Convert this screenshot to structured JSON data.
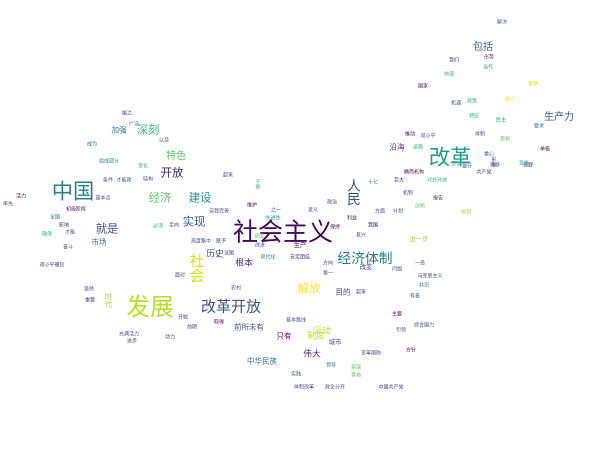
{
  "words": [
    {
      "text": "社会主义",
      "weight": 20,
      "color": "#46085c"
    },
    {
      "text": "发展",
      "weight": 19,
      "color": "#b5de2b"
    },
    {
      "text": "中国",
      "weight": 17,
      "color": "#26828e"
    },
    {
      "text": "改革",
      "weight": 17,
      "color": "#1f9e89"
    },
    {
      "text": "改革开放",
      "weight": 12,
      "color": "#3b528b"
    },
    {
      "text": "经济体制",
      "weight": 11,
      "color": "#287d8e"
    },
    {
      "text": "人民",
      "weight": 11,
      "color": "#3b528b"
    },
    {
      "text": "社会",
      "weight": 12,
      "color": "#d8e219"
    },
    {
      "text": "深刻",
      "weight": 9,
      "color": "#35b779"
    },
    {
      "text": "开放",
      "weight": 9,
      "color": "#2d1f5e"
    },
    {
      "text": "经济",
      "weight": 9,
      "color": "#5ec962"
    },
    {
      "text": "建设",
      "weight": 9,
      "color": "#21918c"
    },
    {
      "text": "实现",
      "weight": 9,
      "color": "#3b528b"
    },
    {
      "text": "就是",
      "weight": 9,
      "color": "#3e4989"
    },
    {
      "text": "特色",
      "weight": 8,
      "color": "#5ec962"
    },
    {
      "text": "解放",
      "weight": 9,
      "color": "#fde725"
    },
    {
      "text": "生产力",
      "weight": 8,
      "color": "#3b528b"
    },
    {
      "text": "包括",
      "weight": 8,
      "color": "#31688e"
    },
    {
      "text": "历史",
      "weight": 7,
      "color": "#404688"
    },
    {
      "text": "根本",
      "weight": 7,
      "color": "#482878"
    },
    {
      "text": "制度",
      "weight": 7,
      "color": "#c2df23"
    },
    {
      "text": "伟大",
      "weight": 7,
      "color": "#472d7b"
    },
    {
      "text": "运动",
      "weight": 7,
      "color": "#b5de2b"
    },
    {
      "text": "前所未有",
      "weight": 6,
      "color": "#39568c"
    },
    {
      "text": "只有",
      "weight": 6,
      "color": "#46085c"
    },
    {
      "text": "沿海",
      "weight": 6,
      "color": "#482475"
    },
    {
      "text": "市场",
      "weight": 6,
      "color": "#31688e"
    },
    {
      "text": "时代",
      "weight": 6,
      "color": "#a0da39"
    },
    {
      "text": "中华民族",
      "weight": 6,
      "color": "#2c728e"
    },
    {
      "text": "加强",
      "weight": 6,
      "color": "#2d708e"
    },
    {
      "text": "目的",
      "weight": 6,
      "color": "#443983"
    },
    {
      "text": "进一步",
      "weight": 5,
      "color": "#a5db36"
    },
    {
      "text": "城市",
      "weight": 5,
      "color": "#3b528b"
    },
    {
      "text": "生产",
      "weight": 5,
      "color": "#46085c"
    },
    {
      "text": "改变",
      "weight": 5,
      "color": "#3e4989"
    },
    {
      "text": "十七",
      "weight": 4,
      "color": "#31688e"
    },
    {
      "text": "主要",
      "weight": 4,
      "color": "#46085c"
    },
    {
      "text": "方针",
      "weight": 4,
      "color": "#46085c"
    },
    {
      "text": "中国共产党",
      "weight": 4,
      "color": "#414487"
    },
    {
      "text": "综合国力",
      "weight": 4,
      "color": "#3b528b"
    },
    {
      "text": "马克思主义",
      "weight": 4,
      "color": "#404688"
    },
    {
      "text": "邓小平",
      "weight": 4,
      "color": "#3e4989"
    },
    {
      "text": "邓小平理论",
      "weight": 4,
      "color": "#482878"
    },
    {
      "text": "体制",
      "weight": 4,
      "color": "#3b528b"
    },
    {
      "text": "机遇",
      "weight": 4,
      "color": "#3b528b"
    },
    {
      "text": "国家",
      "weight": 4,
      "color": "#46085c"
    },
    {
      "text": "我们",
      "weight": 4,
      "color": "#414487"
    },
    {
      "text": "解决",
      "weight": 4,
      "color": "#31688e"
    },
    {
      "text": "形势",
      "weight": 4,
      "color": "#472d7b"
    },
    {
      "text": "当代",
      "weight": 4,
      "color": "#1fa187"
    },
    {
      "text": "快速",
      "weight": 4,
      "color": "#35b779"
    },
    {
      "text": "政策",
      "weight": 4,
      "color": "#35b779"
    },
    {
      "text": "建立",
      "weight": 4,
      "color": "#fde725"
    },
    {
      "text": "繁荣",
      "weight": 4,
      "color": "#d8e219"
    },
    {
      "text": "要求",
      "weight": 4,
      "color": "#2a788e"
    },
    {
      "text": "民主",
      "weight": 4,
      "color": "#22a884"
    },
    {
      "text": "单极",
      "weight": 4,
      "color": "#46085c"
    },
    {
      "text": "意愿",
      "weight": 4,
      "color": "#35b779"
    },
    {
      "text": "形象",
      "weight": 4,
      "color": "#482878"
    },
    {
      "text": "共产党",
      "weight": 4,
      "color": "#404688"
    },
    {
      "text": "推动",
      "weight": 4,
      "color": "#46085c"
    },
    {
      "text": "巨大",
      "weight": 4,
      "color": "#481668"
    },
    {
      "text": "机制",
      "weight": 4,
      "color": "#3e4989"
    },
    {
      "text": "报告",
      "weight": 4,
      "color": "#482878"
    },
    {
      "text": "深化",
      "weight": 4,
      "color": "#35b779"
    },
    {
      "text": "方面",
      "weight": 4,
      "color": "#3e4989"
    },
    {
      "text": "计划",
      "weight": 4,
      "color": "#3b528b"
    },
    {
      "text": "我国",
      "weight": 4,
      "color": "#46085c"
    },
    {
      "text": "复兴",
      "weight": 4,
      "color": "#404688"
    },
    {
      "text": "保持",
      "weight": 4,
      "color": "#46085c"
    },
    {
      "text": "利益",
      "weight": 4,
      "color": "#482878"
    },
    {
      "text": "第一",
      "weight": 4,
      "color": "#3b528b"
    },
    {
      "text": "一员",
      "weight": 4,
      "color": "#3e4989"
    },
    {
      "text": "问题",
      "weight": 4,
      "color": "#3b528b"
    },
    {
      "text": "共识",
      "weight": 4,
      "color": "#2c728e"
    },
    {
      "text": "有着",
      "weight": 4,
      "color": "#31688e"
    },
    {
      "text": "引领",
      "weight": 4,
      "color": "#3b528b"
    },
    {
      "text": "取得",
      "weight": 4,
      "color": "#46085c"
    },
    {
      "text": "基本路线",
      "weight": 4,
      "color": "#3b528b"
    },
    {
      "text": "方向",
      "weight": 4,
      "color": "#3b528b"
    },
    {
      "text": "起来",
      "weight": 4,
      "color": "#3e4989"
    },
    {
      "text": "维护",
      "weight": 4,
      "color": "#46085c"
    },
    {
      "text": "意义",
      "weight": 4,
      "color": "#3b528b"
    },
    {
      "text": "政治",
      "weight": 4,
      "color": "#3e4989"
    },
    {
      "text": "之一",
      "weight": 4,
      "color": "#3b528b"
    },
    {
      "text": "先进性",
      "weight": 4,
      "color": "#20a486"
    },
    {
      "text": "高度集中",
      "weight": 4,
      "color": "#3b528b"
    },
    {
      "text": "赋予",
      "weight": 4,
      "color": "#3e4989"
    },
    {
      "text": "现代化",
      "weight": 4,
      "color": "#2a788e"
    },
    {
      "text": "安定团结",
      "weight": 4,
      "color": "#472d7b"
    },
    {
      "text": "农村",
      "weight": 4,
      "color": "#3e4989"
    },
    {
      "text": "速度",
      "weight": 4,
      "color": "#5ec962"
    },
    {
      "text": "改进",
      "weight": 4,
      "color": "#3b528b"
    },
    {
      "text": "试图",
      "weight": 4,
      "color": "#3e4989"
    },
    {
      "text": "面对",
      "weight": 4,
      "color": "#3e4989"
    },
    {
      "text": "走向",
      "weight": 4,
      "color": "#3b528b"
    },
    {
      "text": "必须",
      "weight": 4,
      "color": "#35b779"
    },
    {
      "text": "全国",
      "weight": 4,
      "color": "#2a788e"
    },
    {
      "text": "影响",
      "weight": 4,
      "color": "#472d7b"
    },
    {
      "text": "初级阶段",
      "weight": 4,
      "color": "#46085c"
    },
    {
      "text": "基本点",
      "weight": 4,
      "color": "#3b528b"
    },
    {
      "text": "条件",
      "weight": 4,
      "color": "#3b528b"
    },
    {
      "text": "才能政",
      "weight": 4,
      "color": "#3b528b"
    },
    {
      "text": "结构",
      "weight": 4,
      "color": "#3b528b"
    },
    {
      "text": "变化",
      "weight": 4,
      "color": "#35b779"
    },
    {
      "text": "起来",
      "weight": 4,
      "color": "#3e4989"
    },
    {
      "text": "以及",
      "weight": 4,
      "color": "#3b528b"
    },
    {
      "text": "成为",
      "weight": 4,
      "color": "#2a788e"
    },
    {
      "text": "组成部分",
      "weight": 4,
      "color": "#21918c"
    },
    {
      "text": "属之",
      "weight": 4,
      "color": "#472d7b"
    },
    {
      "text": "广泛",
      "weight": 4,
      "color": "#3e4989"
    },
    {
      "text": "活力",
      "weight": 4,
      "color": "#46085c"
    },
    {
      "text": "率先",
      "weight": 4,
      "color": "#3b528b"
    },
    {
      "text": "确保",
      "weight": 4,
      "color": "#35b779"
    },
    {
      "text": "才能",
      "weight": 4,
      "color": "#3e4989"
    },
    {
      "text": "奋斗",
      "weight": 4,
      "color": "#3b528b"
    },
    {
      "text": "坚持",
      "weight": 4,
      "color": "#3e4989"
    },
    {
      "text": "重要",
      "weight": 4,
      "color": "#3e4989"
    },
    {
      "text": "充满活力",
      "weight": 4,
      "color": "#3b528b"
    },
    {
      "text": "动力",
      "weight": 4,
      "color": "#3b528b"
    },
    {
      "text": "进步",
      "weight": 4,
      "color": "#3e4989"
    },
    {
      "text": "前期",
      "weight": 4,
      "color": "#3b528b"
    },
    {
      "text": "开始",
      "weight": 4,
      "color": "#472d7b"
    },
    {
      "text": "自我完善",
      "weight": 4,
      "color": "#3b528b"
    },
    {
      "text": "不断",
      "weight": 4,
      "color": "#35b779"
    },
    {
      "text": "体制改革",
      "weight": 4,
      "color": "#3b528b"
    },
    {
      "text": "政企分开",
      "weight": 4,
      "color": "#3e4989"
    },
    {
      "text": "创新",
      "weight": 4,
      "color": "#5ec962"
    },
    {
      "text": "领导",
      "weight": 4,
      "color": "#2a788e"
    },
    {
      "text": "富强",
      "weight": 4,
      "color": "#5ec962"
    },
    {
      "text": "变革",
      "weight": 4,
      "color": "#3b528b"
    },
    {
      "text": "富裕",
      "weight": 4,
      "color": "#5ec962"
    },
    {
      "text": "实践",
      "weight": 4,
      "color": "#3b528b"
    },
    {
      "text": "道路",
      "weight": 4,
      "color": "#35b779"
    },
    {
      "text": "精简机构",
      "weight": 4,
      "color": "#46085c"
    },
    {
      "text": "对外开放",
      "weight": 4,
      "color": "#35b779"
    },
    {
      "text": "银行",
      "weight": 4,
      "color": "#3e4989"
    },
    {
      "text": "规划",
      "weight": 4,
      "color": "#a0da39"
    },
    {
      "text": "重心",
      "weight": 4,
      "color": "#31688e"
    },
    {
      "text": "转移",
      "weight": 4,
      "color": "#31688e"
    },
    {
      "text": "特区",
      "weight": 4,
      "color": "#35b779"
    },
    {
      "text": "视野",
      "weight": 4,
      "color": "#472d7b"
    },
    {
      "text": "思想",
      "weight": 4,
      "color": "#5ec962"
    },
    {
      "text": "国防",
      "weight": 4,
      "color": "#3b528b"
    }
  ]
}
